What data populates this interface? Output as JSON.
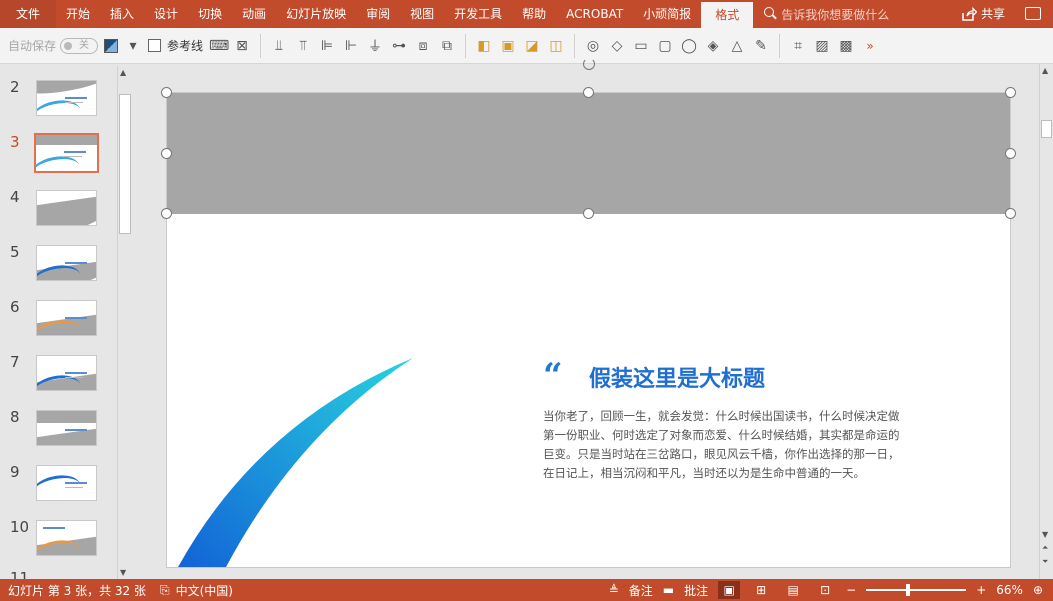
{
  "ribbon": {
    "tabs": [
      "文件",
      "开始",
      "插入",
      "设计",
      "切换",
      "动画",
      "幻灯片放映",
      "审阅",
      "视图",
      "开发工具",
      "帮助",
      "ACROBAT",
      "小顽简报",
      "格式"
    ],
    "active_tab": "格式",
    "tell_me_placeholder": "告诉我你想要做什么",
    "share_label": "共享"
  },
  "toolbar": {
    "autosave_label": "自动保存",
    "autosave_state": "关",
    "guides_label": "参考线"
  },
  "thumbnails": {
    "numbers": [
      "2",
      "3",
      "4",
      "5",
      "6",
      "7",
      "8",
      "9",
      "10",
      "11"
    ],
    "current": "3"
  },
  "slide": {
    "quote_mark": "“",
    "title": "假装这里是大标题",
    "body": "当你老了，回顾一生，就会发觉：什么时候出国读书，什么时候决定做第一份职业、何时选定了对象而恋爱、什么时候结婚，其实都是命运的巨变。只是当时站在三岔路口，眼见风云千樯，你作出选择的那一日，在日记上，相当沉闷和平凡，当时还以为是生命中普通的一天。",
    "banner_color": "#a6a6a6",
    "title_color": "#1f6fd1"
  },
  "status": {
    "slide_info": "幻灯片 第 3 张，共 32 张",
    "language": "中文(中国)",
    "notes_label": "备注",
    "comments_label": "批注",
    "zoom": "66%"
  },
  "colors": {
    "accent": "#c24b2b"
  }
}
